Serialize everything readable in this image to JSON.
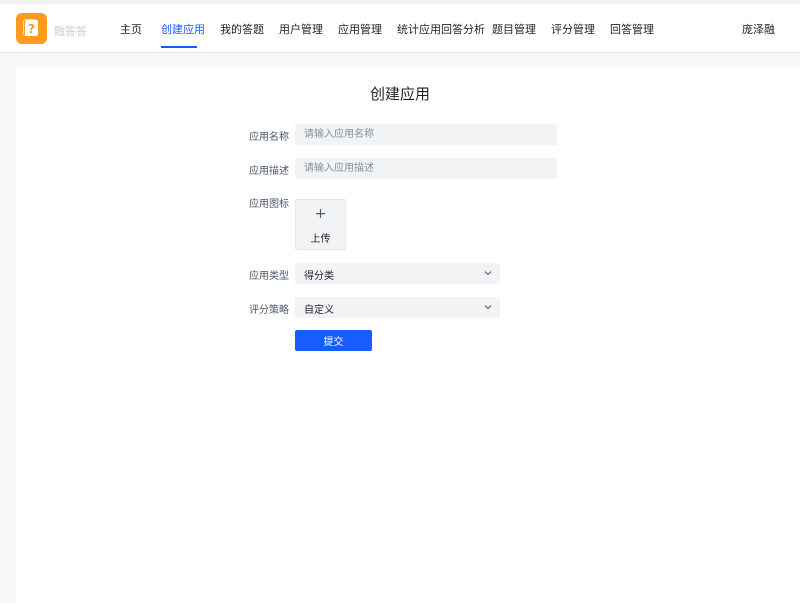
{
  "header": {
    "brand": "融答答",
    "user": "庞泽融",
    "nav": [
      {
        "label": "主页"
      },
      {
        "label": "创建应用"
      },
      {
        "label": "我的答题"
      },
      {
        "label": "用户管理"
      },
      {
        "label": "应用管理"
      },
      {
        "label": "统计应用回答分析"
      },
      {
        "label": "题目管理"
      },
      {
        "label": "评分管理"
      },
      {
        "label": "回答管理"
      }
    ],
    "active_nav": "创建应用"
  },
  "form": {
    "title": "创建应用",
    "app_name": {
      "label": "应用名称",
      "placeholder": "请输入应用名称",
      "value": ""
    },
    "app_desc": {
      "label": "应用描述",
      "placeholder": "请输入应用描述",
      "value": ""
    },
    "app_icon": {
      "label": "应用图标",
      "upload_icon": "+",
      "upload_label": "上传"
    },
    "app_type": {
      "label": "应用类型",
      "value": "得分类"
    },
    "strategy": {
      "label": "评分策略",
      "value": "自定义"
    },
    "submit_label": "提交"
  },
  "icons": {
    "logo": "question-mark-box-icon",
    "dropdown": "chevron-down-icon"
  },
  "colors": {
    "accent": "#165dff",
    "logo": "#ff9a1f",
    "input_bg": "#f2f3f5"
  }
}
